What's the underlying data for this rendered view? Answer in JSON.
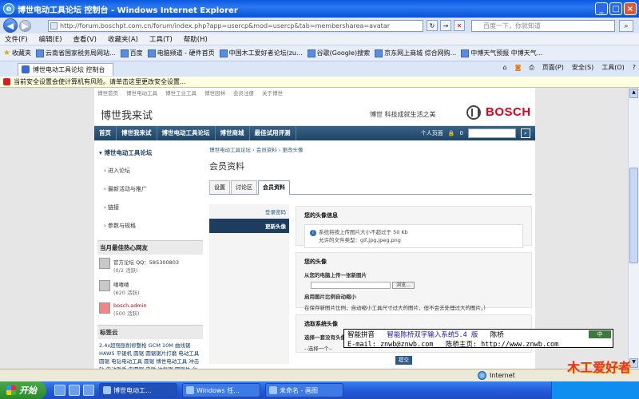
{
  "window": {
    "title": "博世电动工具论坛 控制台 - Windows Internet Explorer",
    "logo": "ie-logo",
    "buttons": [
      "minimize-icon",
      "maximize-icon",
      "close-icon"
    ]
  },
  "address": {
    "url": "http://forum.boschpt.com.cn/forum/index.php?app=usercp&mod=usercp&tab=membersharea=avatar",
    "search_placeholder": "百度一下，你就知道"
  },
  "menu": [
    "文件(F)",
    "编辑(E)",
    "查看(V)",
    "收藏夹(A)",
    "工具(T)",
    "帮助(H)"
  ],
  "favorites": {
    "label": "收藏夹",
    "items": [
      "云南省国家税务局网站...",
      "百度",
      "电脑频道 - 硬件首页",
      "中国木工爱好者论坛(zu...",
      "谷歌(Google)搜索",
      "京东网上商城 综合网购...",
      "中博天气预报 中博天气..."
    ]
  },
  "tab": {
    "label": "博世电动工具论坛 控制台"
  },
  "commandbar": [
    "页面(P)",
    "安全(S)",
    "工具(O)"
  ],
  "infobar": "当前安全设置会使计算机有风险。请单击这里更改安全设置...",
  "site": {
    "topnav": [
      "博世首页",
      "博世电动工具",
      "博世工业工具",
      "博世园林",
      "会员注册",
      "关于博世"
    ],
    "title": "博世我来试",
    "slogan_cn": "博世",
    "slogan": "科技成就生活之美",
    "brand": "BOSCH",
    "mainnav": [
      "首页",
      "博世我来试",
      "博世电动工具论坛",
      "博世商城",
      "最佳试用评测"
    ],
    "user_center": "个人页面",
    "user_count": "0"
  },
  "sidebar": {
    "heading": "博世电动工具论坛",
    "links": [
      "进入论坛",
      "最新活动与推广",
      "链接",
      "参数与规格"
    ],
    "helpers_title": "当月最佳热心网友",
    "helpers": [
      {
        "name": "官方论坛 QQ：585300803",
        "meta": "(0/2 活跃)"
      },
      {
        "name": "嘻嘻嘻",
        "meta": "(620 活跃)"
      },
      {
        "name": "bosch.admin",
        "meta": "(500 活跃)"
      }
    ],
    "tags_title": "标签云",
    "tags": "2.4v超强刨削修整枪 GCM 10M 曲线锯 HAWS 平锯机 圆锯 圆锯锯片打磨 电动工具 圆锯 电钻电动工具 圆锯 博世电动工具 冲击钻 电动扳手 电圆锯 电锤 往复锯 圆锯片 台钻 多功能工具 角磨机 切割机"
  },
  "content": {
    "breadcrumb": "博世电动工具论坛 › 会员资料 › 更改头像",
    "title": "会员资料",
    "tabs": [
      "设置",
      "讨论区",
      "会员资料"
    ],
    "subnav": [
      "登录密码",
      "更新头像"
    ],
    "avatar_box": {
      "title": "您的头像信息",
      "note1": "系统将按上传图片大小不超过于 50 Kb",
      "note2": "允许的文件类型：gif,jpg,jpeg,png"
    },
    "upload_box": {
      "title": "您的头像",
      "from_pc": "从您的电脑上传一张新图片",
      "browse": "浏览...",
      "resize_title": "启用图片比例自动缩小",
      "resize_desc": "在保存新图片比例，自动缩小工具尺寸过大的图片，但不会去处理过大的图片。）"
    },
    "default_box": {
      "title": "选取系统头像",
      "label": "选择一套没有头像",
      "select": "--选择一个--"
    },
    "submit": "提交"
  },
  "ime": {
    "line1_a": "智能拼音",
    "line1_b": "智能陈桥双字输入系统5.4 版",
    "line1_c": "陈桥",
    "line2_a": "E-mail: znwb@znwb.com",
    "line2_b": "陈桥主页: http://www.znwb.com",
    "mini": "中"
  },
  "status": {
    "zone": "Internet"
  },
  "taskbar": {
    "start": "开始",
    "tasks": [
      "博世电动工...",
      "Windows 任...",
      "未命名 - 画图"
    ]
  },
  "watermark": "木工爱好者"
}
